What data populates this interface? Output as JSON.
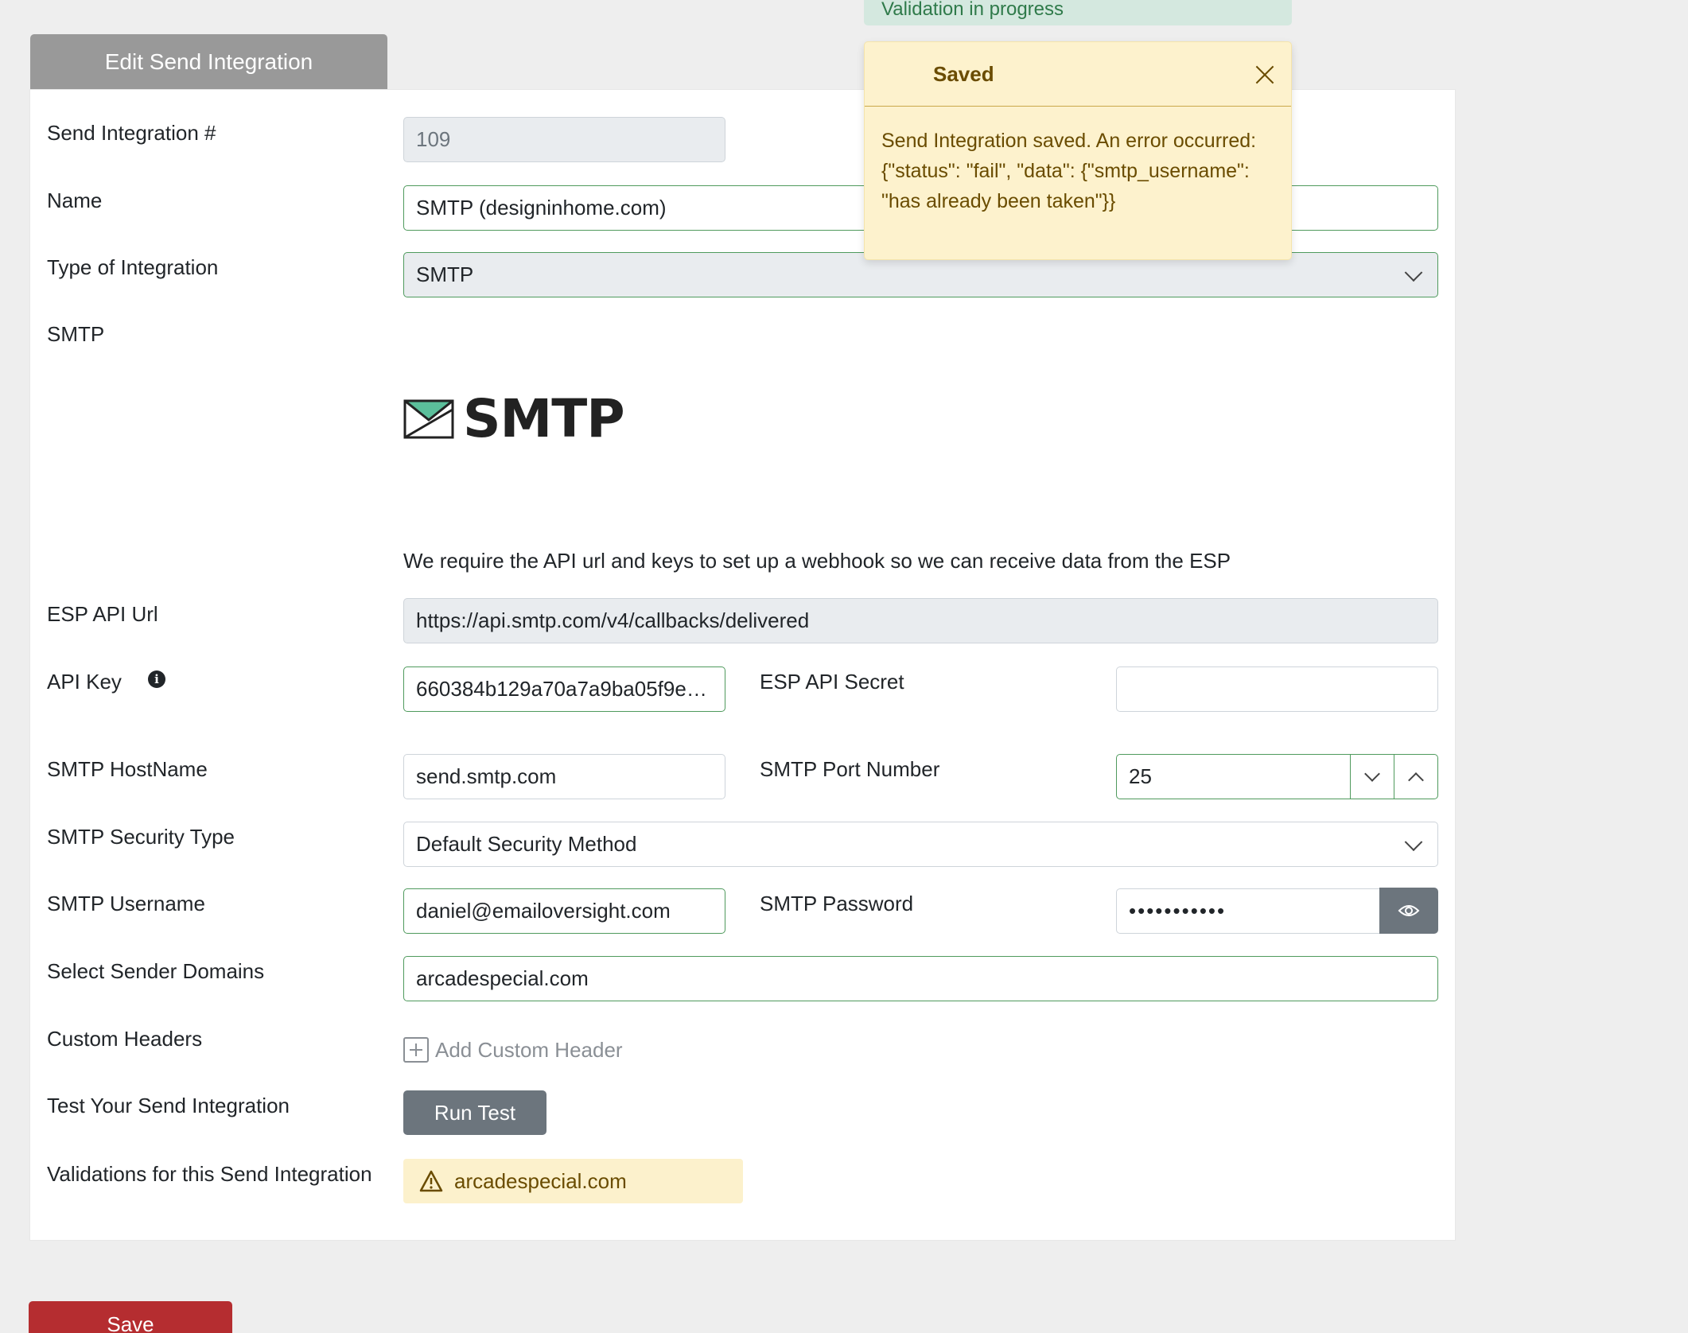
{
  "tab": {
    "title": "Edit Send Integration"
  },
  "form": {
    "integration_number": {
      "label": "Send Integration #",
      "value": "109"
    },
    "name": {
      "label": "Name",
      "value": "SMTP (designinhome.com)"
    },
    "type": {
      "label": "Type of Integration",
      "value": "SMTP"
    },
    "provider": {
      "label": "SMTP",
      "logo_text": "SMTP"
    },
    "note": "We require the API url and keys to set up a webhook so we can receive data from the ESP",
    "esp_api_url": {
      "label": "ESP API Url",
      "value": "https://api.smtp.com/v4/callbacks/delivered"
    },
    "api_key": {
      "label": "API Key",
      "value": "660384b129a70a7a9ba05f9e7..."
    },
    "esp_api_secret": {
      "label": "ESP API Secret",
      "value": ""
    },
    "smtp_hostname": {
      "label": "SMTP HostName",
      "value": "send.smtp.com"
    },
    "smtp_port": {
      "label": "SMTP Port Number",
      "value": "25"
    },
    "smtp_security": {
      "label": "SMTP Security Type",
      "value": "Default Security Method"
    },
    "smtp_username": {
      "label": "SMTP Username",
      "value": "daniel@emailoversight.com"
    },
    "smtp_password": {
      "label": "SMTP Password",
      "value": "•••••••••••"
    },
    "sender_domains": {
      "label": "Select Sender Domains",
      "value": "arcadespecial.com"
    },
    "custom_headers": {
      "label": "Custom Headers",
      "add_label": "Add Custom Header"
    },
    "test": {
      "label": "Test Your Send Integration",
      "button": "Run Test"
    },
    "validations": {
      "label": "Validations for this Send Integration",
      "badge": "arcadespecial.com"
    }
  },
  "save_button": "Save",
  "toasts": {
    "progress": {
      "text": "Validation in progress"
    },
    "saved": {
      "title": "Saved",
      "message": "Send Integration saved. An error occurred: {\"status\": \"fail\", \"data\": {\"smtp_username\": \"has already been taken\"}}"
    }
  },
  "colors": {
    "accent_green": "#4f9a5d",
    "save_red": "#b52d30",
    "warning_bg": "#fdf2cd",
    "warning_text": "#6a4c00",
    "secondary_grey": "#6c757d"
  }
}
